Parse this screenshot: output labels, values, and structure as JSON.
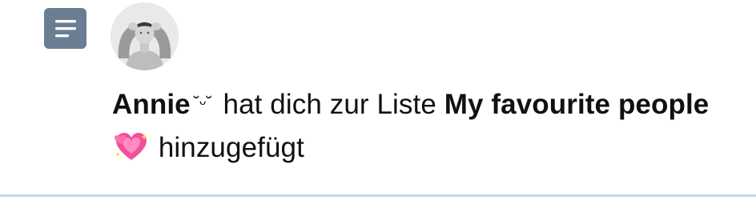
{
  "notification": {
    "icon": "list-icon",
    "avatar": "avatar-photo",
    "actor_name": "Annie",
    "actor_kaomoji": "˘ᵕ˘",
    "action_text": "hat dich zur Liste",
    "list_name_part1": "My favourite",
    "list_name_part2": "people",
    "list_emoji": "sparkling-hearts-emoji",
    "suffix_text": "hinzugefügt"
  },
  "colors": {
    "icon_background": "#6b7d92",
    "divider": "#c8d6e0",
    "text": "#111111",
    "emoji_pink": "#f2509a"
  }
}
